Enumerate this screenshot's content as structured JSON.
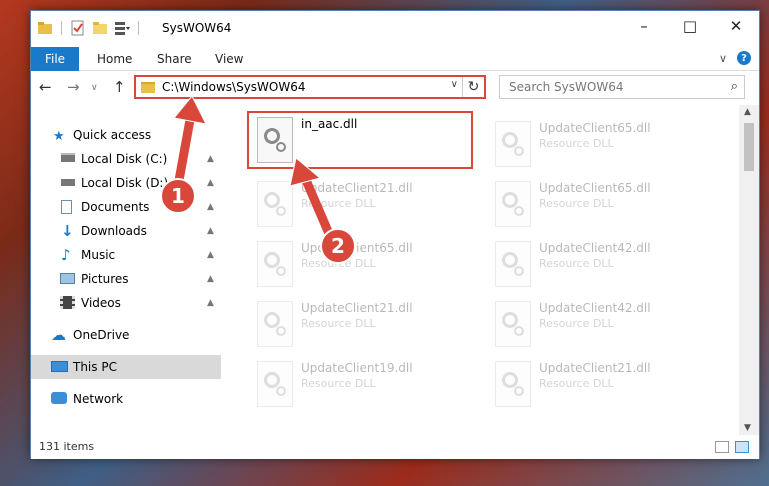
{
  "window": {
    "title": "SysWOW64"
  },
  "ribbon": {
    "tabs": [
      "File",
      "Home",
      "Share",
      "View"
    ]
  },
  "navigation": {
    "back_icon": "back-arrow-icon",
    "forward_icon": "forward-arrow-icon",
    "up_icon": "up-arrow-icon",
    "address_path": "C:\\Windows\\SysWOW64",
    "search_placeholder": "Search SysWOW64"
  },
  "sidebar": {
    "items": [
      {
        "label": "Quick access",
        "icon": "star-icon",
        "pinned": false
      },
      {
        "label": "Local Disk (C:)",
        "icon": "drive-icon",
        "pinned": true
      },
      {
        "label": "Local Disk (D:)",
        "icon": "drive-icon",
        "pinned": true
      },
      {
        "label": "Documents",
        "icon": "documents-icon",
        "pinned": true
      },
      {
        "label": "Downloads",
        "icon": "download-icon",
        "pinned": true
      },
      {
        "label": "Music",
        "icon": "music-icon",
        "pinned": true
      },
      {
        "label": "Pictures",
        "icon": "pictures-icon",
        "pinned": true
      },
      {
        "label": "Videos",
        "icon": "videos-icon",
        "pinned": true
      },
      {
        "label": "OneDrive",
        "icon": "cloud-icon",
        "pinned": false
      },
      {
        "label": "This PC",
        "icon": "computer-icon",
        "pinned": false,
        "selected": true
      },
      {
        "label": "Network",
        "icon": "network-icon",
        "pinned": false
      }
    ]
  },
  "files": [
    {
      "name": "in_aac.dll",
      "type": "",
      "highlighted": true
    },
    {
      "name": "UpdateClient65.dll",
      "type": "Resource DLL"
    },
    {
      "name": "UpdateClient21.dll",
      "type": "Resource DLL"
    },
    {
      "name": "UpdateClient65.dll",
      "type": "Resource DLL"
    },
    {
      "name": "UpdateClient65.dll",
      "type": "Resource DLL"
    },
    {
      "name": "UpdateClient42.dll",
      "type": "Resource DLL"
    },
    {
      "name": "UpdateClient21.dll",
      "type": "Resource DLL"
    },
    {
      "name": "UpdateClient42.dll",
      "type": "Resource DLL"
    },
    {
      "name": "UpdateClient19.dll",
      "type": "Resource DLL"
    },
    {
      "name": "UpdateClient21.dll",
      "type": "Resource DLL"
    }
  ],
  "status": {
    "item_count": "131 items"
  },
  "callouts": [
    "1",
    "2"
  ],
  "colors": {
    "accent": "#1979ca",
    "highlight": "#d9473a"
  }
}
